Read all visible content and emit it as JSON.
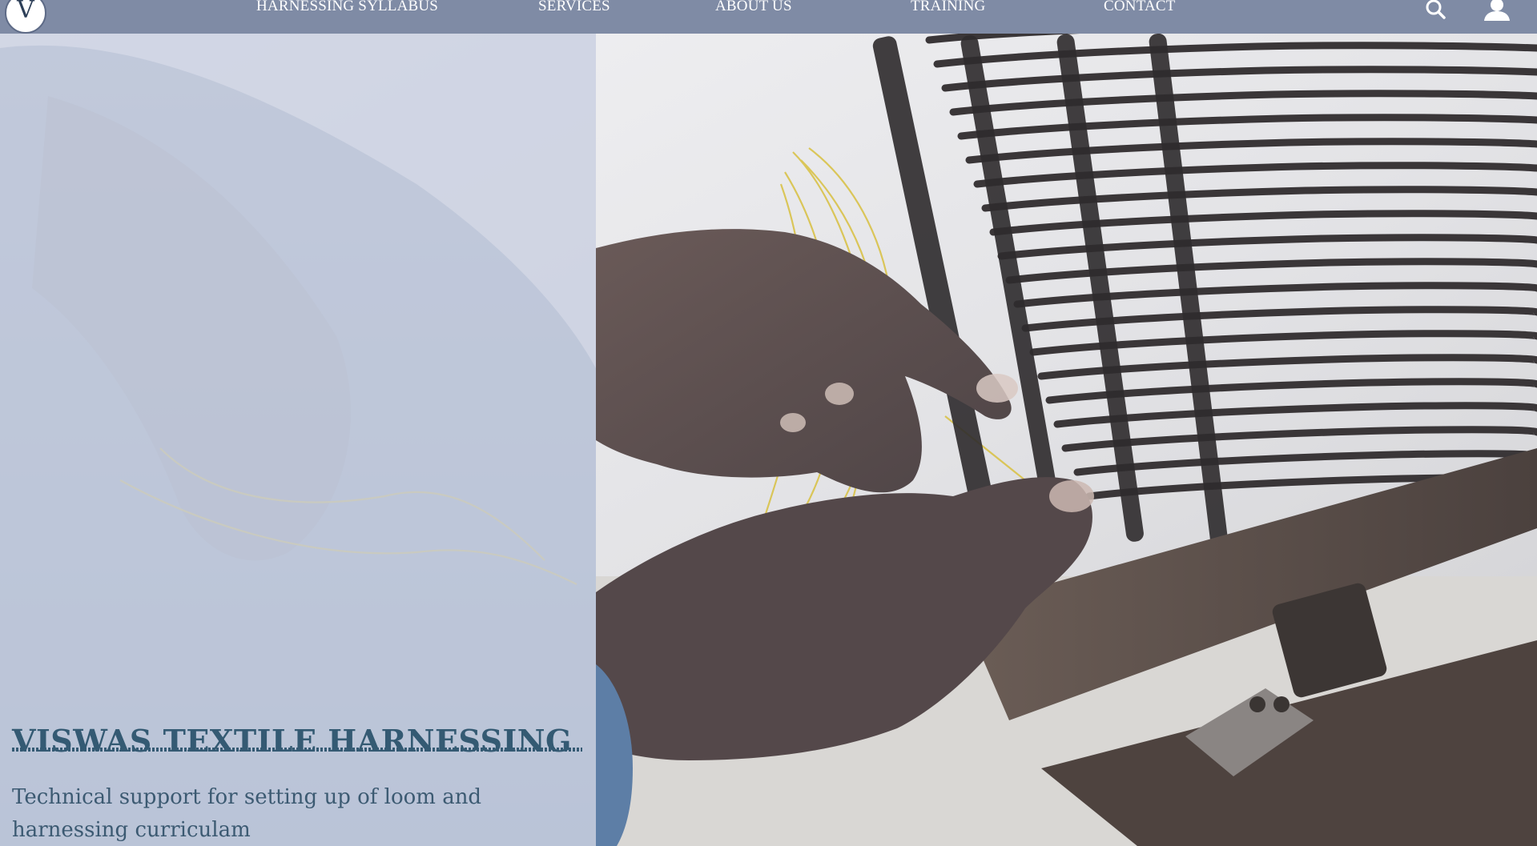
{
  "brand": {
    "logo_letter": "V"
  },
  "nav": {
    "items": [
      {
        "label": "HARNESSING SYLLABUS"
      },
      {
        "label": "SERVICES"
      },
      {
        "label": "ABOUT US"
      },
      {
        "label": "TRAINING"
      },
      {
        "label": "CONTACT"
      }
    ],
    "icons": [
      "search-icon",
      "user-icon"
    ]
  },
  "hero": {
    "title": "VISWAS TEXTILE HARNESSING",
    "subtitle": "Technical support for setting up of loom and harnessing curriculam",
    "image_subject": "hands-threading-loom-harness"
  },
  "colors": {
    "nav_bg": "#7f8ba5",
    "title_text": "#345a73",
    "left_overlay": "#c8cee0"
  }
}
